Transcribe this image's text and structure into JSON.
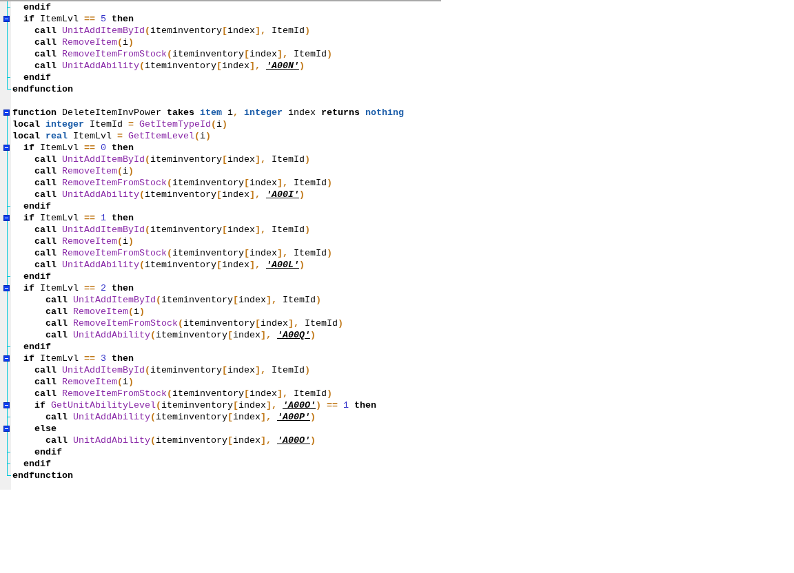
{
  "editor": {
    "lines": [
      {
        "kind": "tick",
        "tokens": [
          {
            "kind": "keyword",
            "text": "  endif"
          }
        ]
      },
      {
        "kind": "box",
        "tokens": [
          {
            "kind": "keyword",
            "text": "  if"
          },
          {
            "kind": "plain",
            "text": " ItemLvl "
          },
          {
            "kind": "punct",
            "text": "== "
          },
          {
            "kind": "number",
            "text": "5 "
          },
          {
            "kind": "keyword",
            "text": "then"
          }
        ]
      },
      {
        "kind": "line",
        "tokens": [
          {
            "kind": "keyword",
            "text": "    call "
          },
          {
            "kind": "function",
            "text": "UnitAddItemById"
          },
          {
            "kind": "punct",
            "text": "("
          },
          {
            "kind": "plain",
            "text": "iteminventory"
          },
          {
            "kind": "punct",
            "text": "["
          },
          {
            "kind": "plain",
            "text": "index"
          },
          {
            "kind": "punct",
            "text": "], "
          },
          {
            "kind": "plain",
            "text": "ItemId"
          },
          {
            "kind": "punct",
            "text": ")"
          }
        ]
      },
      {
        "kind": "line",
        "tokens": [
          {
            "kind": "keyword",
            "text": "    call "
          },
          {
            "kind": "function",
            "text": "RemoveItem"
          },
          {
            "kind": "punct",
            "text": "("
          },
          {
            "kind": "plain",
            "text": "i"
          },
          {
            "kind": "punct",
            "text": ")"
          }
        ]
      },
      {
        "kind": "line",
        "tokens": [
          {
            "kind": "keyword",
            "text": "    call "
          },
          {
            "kind": "function",
            "text": "RemoveItemFromStock"
          },
          {
            "kind": "punct",
            "text": "("
          },
          {
            "kind": "plain",
            "text": "iteminventory"
          },
          {
            "kind": "punct",
            "text": "["
          },
          {
            "kind": "plain",
            "text": "index"
          },
          {
            "kind": "punct",
            "text": "], "
          },
          {
            "kind": "plain",
            "text": "ItemId"
          },
          {
            "kind": "punct",
            "text": ")"
          }
        ]
      },
      {
        "kind": "line",
        "tokens": [
          {
            "kind": "keyword",
            "text": "    call "
          },
          {
            "kind": "function",
            "text": "UnitAddAbility"
          },
          {
            "kind": "punct",
            "text": "("
          },
          {
            "kind": "plain",
            "text": "iteminventory"
          },
          {
            "kind": "punct",
            "text": "["
          },
          {
            "kind": "plain",
            "text": "index"
          },
          {
            "kind": "punct",
            "text": "], "
          },
          {
            "kind": "string",
            "text": "'A00N'"
          },
          {
            "kind": "punct",
            "text": ")"
          }
        ]
      },
      {
        "kind": "tick",
        "tokens": [
          {
            "kind": "keyword",
            "text": "  endif"
          }
        ]
      },
      {
        "kind": "end",
        "tokens": [
          {
            "kind": "keyword",
            "text": "endfunction"
          }
        ]
      },
      {
        "kind": "none"
      },
      {
        "kind": "head",
        "tokens": [
          {
            "kind": "keyword",
            "text": "function"
          },
          {
            "kind": "plain",
            "text": " DeleteItemInvPower "
          },
          {
            "kind": "keyword",
            "text": "takes "
          },
          {
            "kind": "type",
            "text": "item"
          },
          {
            "kind": "plain",
            "text": " i"
          },
          {
            "kind": "punct",
            "text": ", "
          },
          {
            "kind": "type",
            "text": "integer"
          },
          {
            "kind": "plain",
            "text": " index "
          },
          {
            "kind": "keyword",
            "text": "returns "
          },
          {
            "kind": "type",
            "text": "nothing"
          }
        ]
      },
      {
        "kind": "line",
        "tokens": [
          {
            "kind": "keyword",
            "text": "local "
          },
          {
            "kind": "type",
            "text": "integer"
          },
          {
            "kind": "plain",
            "text": " ItemId "
          },
          {
            "kind": "punct",
            "text": "= "
          },
          {
            "kind": "function",
            "text": "GetItemTypeId"
          },
          {
            "kind": "punct",
            "text": "("
          },
          {
            "kind": "plain",
            "text": "i"
          },
          {
            "kind": "punct",
            "text": ")"
          }
        ]
      },
      {
        "kind": "line",
        "tokens": [
          {
            "kind": "keyword",
            "text": "local "
          },
          {
            "kind": "type",
            "text": "real"
          },
          {
            "kind": "plain",
            "text": " ItemLvl "
          },
          {
            "kind": "punct",
            "text": "= "
          },
          {
            "kind": "function",
            "text": "GetItemLevel"
          },
          {
            "kind": "punct",
            "text": "("
          },
          {
            "kind": "plain",
            "text": "i"
          },
          {
            "kind": "punct",
            "text": ")"
          }
        ]
      },
      {
        "kind": "box",
        "tokens": [
          {
            "kind": "keyword",
            "text": "  if"
          },
          {
            "kind": "plain",
            "text": " ItemLvl "
          },
          {
            "kind": "punct",
            "text": "== "
          },
          {
            "kind": "number",
            "text": "0 "
          },
          {
            "kind": "keyword",
            "text": "then"
          }
        ]
      },
      {
        "kind": "line",
        "tokens": [
          {
            "kind": "keyword",
            "text": "    call "
          },
          {
            "kind": "function",
            "text": "UnitAddItemById"
          },
          {
            "kind": "punct",
            "text": "("
          },
          {
            "kind": "plain",
            "text": "iteminventory"
          },
          {
            "kind": "punct",
            "text": "["
          },
          {
            "kind": "plain",
            "text": "index"
          },
          {
            "kind": "punct",
            "text": "], "
          },
          {
            "kind": "plain",
            "text": "ItemId"
          },
          {
            "kind": "punct",
            "text": ")"
          }
        ]
      },
      {
        "kind": "line",
        "tokens": [
          {
            "kind": "keyword",
            "text": "    call "
          },
          {
            "kind": "function",
            "text": "RemoveItem"
          },
          {
            "kind": "punct",
            "text": "("
          },
          {
            "kind": "plain",
            "text": "i"
          },
          {
            "kind": "punct",
            "text": ")"
          }
        ]
      },
      {
        "kind": "line",
        "tokens": [
          {
            "kind": "keyword",
            "text": "    call "
          },
          {
            "kind": "function",
            "text": "RemoveItemFromStock"
          },
          {
            "kind": "punct",
            "text": "("
          },
          {
            "kind": "plain",
            "text": "iteminventory"
          },
          {
            "kind": "punct",
            "text": "["
          },
          {
            "kind": "plain",
            "text": "index"
          },
          {
            "kind": "punct",
            "text": "], "
          },
          {
            "kind": "plain",
            "text": "ItemId"
          },
          {
            "kind": "punct",
            "text": ")"
          }
        ]
      },
      {
        "kind": "line",
        "tokens": [
          {
            "kind": "keyword",
            "text": "    call "
          },
          {
            "kind": "function",
            "text": "UnitAddAbility"
          },
          {
            "kind": "punct",
            "text": "("
          },
          {
            "kind": "plain",
            "text": "iteminventory"
          },
          {
            "kind": "punct",
            "text": "["
          },
          {
            "kind": "plain",
            "text": "index"
          },
          {
            "kind": "punct",
            "text": "], "
          },
          {
            "kind": "string",
            "text": "'A00I'"
          },
          {
            "kind": "punct",
            "text": ")"
          }
        ]
      },
      {
        "kind": "tick",
        "tokens": [
          {
            "kind": "keyword",
            "text": "  endif"
          }
        ]
      },
      {
        "kind": "box",
        "tokens": [
          {
            "kind": "keyword",
            "text": "  if"
          },
          {
            "kind": "plain",
            "text": " ItemLvl "
          },
          {
            "kind": "punct",
            "text": "== "
          },
          {
            "kind": "number",
            "text": "1 "
          },
          {
            "kind": "keyword",
            "text": "then"
          }
        ]
      },
      {
        "kind": "line",
        "tokens": [
          {
            "kind": "keyword",
            "text": "    call "
          },
          {
            "kind": "function",
            "text": "UnitAddItemById"
          },
          {
            "kind": "punct",
            "text": "("
          },
          {
            "kind": "plain",
            "text": "iteminventory"
          },
          {
            "kind": "punct",
            "text": "["
          },
          {
            "kind": "plain",
            "text": "index"
          },
          {
            "kind": "punct",
            "text": "], "
          },
          {
            "kind": "plain",
            "text": "ItemId"
          },
          {
            "kind": "punct",
            "text": ")"
          }
        ]
      },
      {
        "kind": "line",
        "tokens": [
          {
            "kind": "keyword",
            "text": "    call "
          },
          {
            "kind": "function",
            "text": "RemoveItem"
          },
          {
            "kind": "punct",
            "text": "("
          },
          {
            "kind": "plain",
            "text": "i"
          },
          {
            "kind": "punct",
            "text": ")"
          }
        ]
      },
      {
        "kind": "line",
        "tokens": [
          {
            "kind": "keyword",
            "text": "    call "
          },
          {
            "kind": "function",
            "text": "RemoveItemFromStock"
          },
          {
            "kind": "punct",
            "text": "("
          },
          {
            "kind": "plain",
            "text": "iteminventory"
          },
          {
            "kind": "punct",
            "text": "["
          },
          {
            "kind": "plain",
            "text": "index"
          },
          {
            "kind": "punct",
            "text": "], "
          },
          {
            "kind": "plain",
            "text": "ItemId"
          },
          {
            "kind": "punct",
            "text": ")"
          }
        ]
      },
      {
        "kind": "line",
        "tokens": [
          {
            "kind": "keyword",
            "text": "    call "
          },
          {
            "kind": "function",
            "text": "UnitAddAbility"
          },
          {
            "kind": "punct",
            "text": "("
          },
          {
            "kind": "plain",
            "text": "iteminventory"
          },
          {
            "kind": "punct",
            "text": "["
          },
          {
            "kind": "plain",
            "text": "index"
          },
          {
            "kind": "punct",
            "text": "], "
          },
          {
            "kind": "string",
            "text": "'A00L'"
          },
          {
            "kind": "punct",
            "text": ")"
          }
        ]
      },
      {
        "kind": "tick",
        "tokens": [
          {
            "kind": "keyword",
            "text": "  endif"
          }
        ]
      },
      {
        "kind": "box",
        "tokens": [
          {
            "kind": "keyword",
            "text": "  if"
          },
          {
            "kind": "plain",
            "text": " ItemLvl "
          },
          {
            "kind": "punct",
            "text": "== "
          },
          {
            "kind": "number",
            "text": "2 "
          },
          {
            "kind": "keyword",
            "text": "then"
          }
        ]
      },
      {
        "kind": "line",
        "tokens": [
          {
            "kind": "keyword",
            "text": "      call "
          },
          {
            "kind": "function",
            "text": "UnitAddItemById"
          },
          {
            "kind": "punct",
            "text": "("
          },
          {
            "kind": "plain",
            "text": "iteminventory"
          },
          {
            "kind": "punct",
            "text": "["
          },
          {
            "kind": "plain",
            "text": "index"
          },
          {
            "kind": "punct",
            "text": "], "
          },
          {
            "kind": "plain",
            "text": "ItemId"
          },
          {
            "kind": "punct",
            "text": ")"
          }
        ]
      },
      {
        "kind": "line",
        "tokens": [
          {
            "kind": "keyword",
            "text": "      call "
          },
          {
            "kind": "function",
            "text": "RemoveItem"
          },
          {
            "kind": "punct",
            "text": "("
          },
          {
            "kind": "plain",
            "text": "i"
          },
          {
            "kind": "punct",
            "text": ")"
          }
        ]
      },
      {
        "kind": "line",
        "tokens": [
          {
            "kind": "keyword",
            "text": "      call "
          },
          {
            "kind": "function",
            "text": "RemoveItemFromStock"
          },
          {
            "kind": "punct",
            "text": "("
          },
          {
            "kind": "plain",
            "text": "iteminventory"
          },
          {
            "kind": "punct",
            "text": "["
          },
          {
            "kind": "plain",
            "text": "index"
          },
          {
            "kind": "punct",
            "text": "], "
          },
          {
            "kind": "plain",
            "text": "ItemId"
          },
          {
            "kind": "punct",
            "text": ")"
          }
        ]
      },
      {
        "kind": "line",
        "tokens": [
          {
            "kind": "keyword",
            "text": "      call "
          },
          {
            "kind": "function",
            "text": "UnitAddAbility"
          },
          {
            "kind": "punct",
            "text": "("
          },
          {
            "kind": "plain",
            "text": "iteminventory"
          },
          {
            "kind": "punct",
            "text": "["
          },
          {
            "kind": "plain",
            "text": "index"
          },
          {
            "kind": "punct",
            "text": "], "
          },
          {
            "kind": "string",
            "text": "'A00Q'"
          },
          {
            "kind": "punct",
            "text": ")"
          }
        ]
      },
      {
        "kind": "tick",
        "tokens": [
          {
            "kind": "keyword",
            "text": "  endif"
          }
        ]
      },
      {
        "kind": "box",
        "tokens": [
          {
            "kind": "keyword",
            "text": "  if"
          },
          {
            "kind": "plain",
            "text": " ItemLvl "
          },
          {
            "kind": "punct",
            "text": "== "
          },
          {
            "kind": "number",
            "text": "3 "
          },
          {
            "kind": "keyword",
            "text": "then"
          }
        ]
      },
      {
        "kind": "line",
        "tokens": [
          {
            "kind": "keyword",
            "text": "    call "
          },
          {
            "kind": "function",
            "text": "UnitAddItemById"
          },
          {
            "kind": "punct",
            "text": "("
          },
          {
            "kind": "plain",
            "text": "iteminventory"
          },
          {
            "kind": "punct",
            "text": "["
          },
          {
            "kind": "plain",
            "text": "index"
          },
          {
            "kind": "punct",
            "text": "], "
          },
          {
            "kind": "plain",
            "text": "ItemId"
          },
          {
            "kind": "punct",
            "text": ")"
          }
        ]
      },
      {
        "kind": "line",
        "tokens": [
          {
            "kind": "keyword",
            "text": "    call "
          },
          {
            "kind": "function",
            "text": "RemoveItem"
          },
          {
            "kind": "punct",
            "text": "("
          },
          {
            "kind": "plain",
            "text": "i"
          },
          {
            "kind": "punct",
            "text": ")"
          }
        ]
      },
      {
        "kind": "line",
        "tokens": [
          {
            "kind": "keyword",
            "text": "    call "
          },
          {
            "kind": "function",
            "text": "RemoveItemFromStock"
          },
          {
            "kind": "punct",
            "text": "("
          },
          {
            "kind": "plain",
            "text": "iteminventory"
          },
          {
            "kind": "punct",
            "text": "["
          },
          {
            "kind": "plain",
            "text": "index"
          },
          {
            "kind": "punct",
            "text": "], "
          },
          {
            "kind": "plain",
            "text": "ItemId"
          },
          {
            "kind": "punct",
            "text": ")"
          }
        ]
      },
      {
        "kind": "box",
        "tokens": [
          {
            "kind": "keyword",
            "text": "    if "
          },
          {
            "kind": "function",
            "text": "GetUnitAbilityLevel"
          },
          {
            "kind": "punct",
            "text": "("
          },
          {
            "kind": "plain",
            "text": "iteminventory"
          },
          {
            "kind": "punct",
            "text": "["
          },
          {
            "kind": "plain",
            "text": "index"
          },
          {
            "kind": "punct",
            "text": "], "
          },
          {
            "kind": "string",
            "text": "'A00O'"
          },
          {
            "kind": "punct",
            "text": ") == "
          },
          {
            "kind": "number",
            "text": "1 "
          },
          {
            "kind": "keyword",
            "text": "then"
          }
        ]
      },
      {
        "kind": "tick",
        "tokens": [
          {
            "kind": "keyword",
            "text": "      call "
          },
          {
            "kind": "function",
            "text": "UnitAddAbility"
          },
          {
            "kind": "punct",
            "text": "("
          },
          {
            "kind": "plain",
            "text": "iteminventory"
          },
          {
            "kind": "punct",
            "text": "["
          },
          {
            "kind": "plain",
            "text": "index"
          },
          {
            "kind": "punct",
            "text": "], "
          },
          {
            "kind": "string",
            "text": "'A00P'"
          },
          {
            "kind": "punct",
            "text": ")"
          }
        ]
      },
      {
        "kind": "box",
        "tokens": [
          {
            "kind": "keyword",
            "text": "    else"
          }
        ]
      },
      {
        "kind": "line",
        "tokens": [
          {
            "kind": "keyword",
            "text": "      call "
          },
          {
            "kind": "function",
            "text": "UnitAddAbility"
          },
          {
            "kind": "punct",
            "text": "("
          },
          {
            "kind": "plain",
            "text": "iteminventory"
          },
          {
            "kind": "punct",
            "text": "["
          },
          {
            "kind": "plain",
            "text": "index"
          },
          {
            "kind": "punct",
            "text": "], "
          },
          {
            "kind": "string",
            "text": "'A00O'"
          },
          {
            "kind": "punct",
            "text": ")"
          }
        ]
      },
      {
        "kind": "tick",
        "tokens": [
          {
            "kind": "keyword",
            "text": "    endif"
          }
        ]
      },
      {
        "kind": "tick",
        "tokens": [
          {
            "kind": "keyword",
            "text": "  endif"
          }
        ]
      },
      {
        "kind": "end",
        "tokens": [
          {
            "kind": "keyword",
            "text": "endfunction"
          }
        ]
      }
    ]
  }
}
